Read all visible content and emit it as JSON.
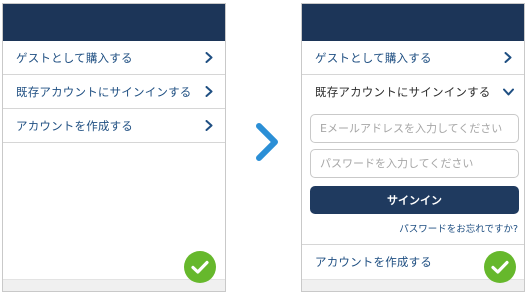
{
  "left_screen": {
    "menu": [
      {
        "label": "ゲストとして購入する"
      },
      {
        "label": "既存アカウントにサインインする"
      },
      {
        "label": "アカウントを作成する"
      }
    ]
  },
  "right_screen": {
    "menu": [
      {
        "label": "ゲストとして購入する"
      },
      {
        "label": "既存アカウントにサインインする"
      }
    ],
    "email_placeholder": "Eメールアドレスを入力してください",
    "password_placeholder": "パスワードを入力してください",
    "signin_label": "サインイン",
    "forgot_label": "パスワードをお忘れですか?",
    "create_account_label": "アカウントを作成する"
  },
  "icons": {
    "row_chevron": "chevron-right-icon",
    "expanded_chevron": "chevron-down-icon",
    "transition_arrow": "chevron-right-icon",
    "success_badge": "checkmark-icon"
  },
  "colors": {
    "header": "#1c3558",
    "link": "#1f4f82",
    "button": "#1f3a5f",
    "arrow": "#2b8fd6",
    "check": "#66b82c"
  }
}
